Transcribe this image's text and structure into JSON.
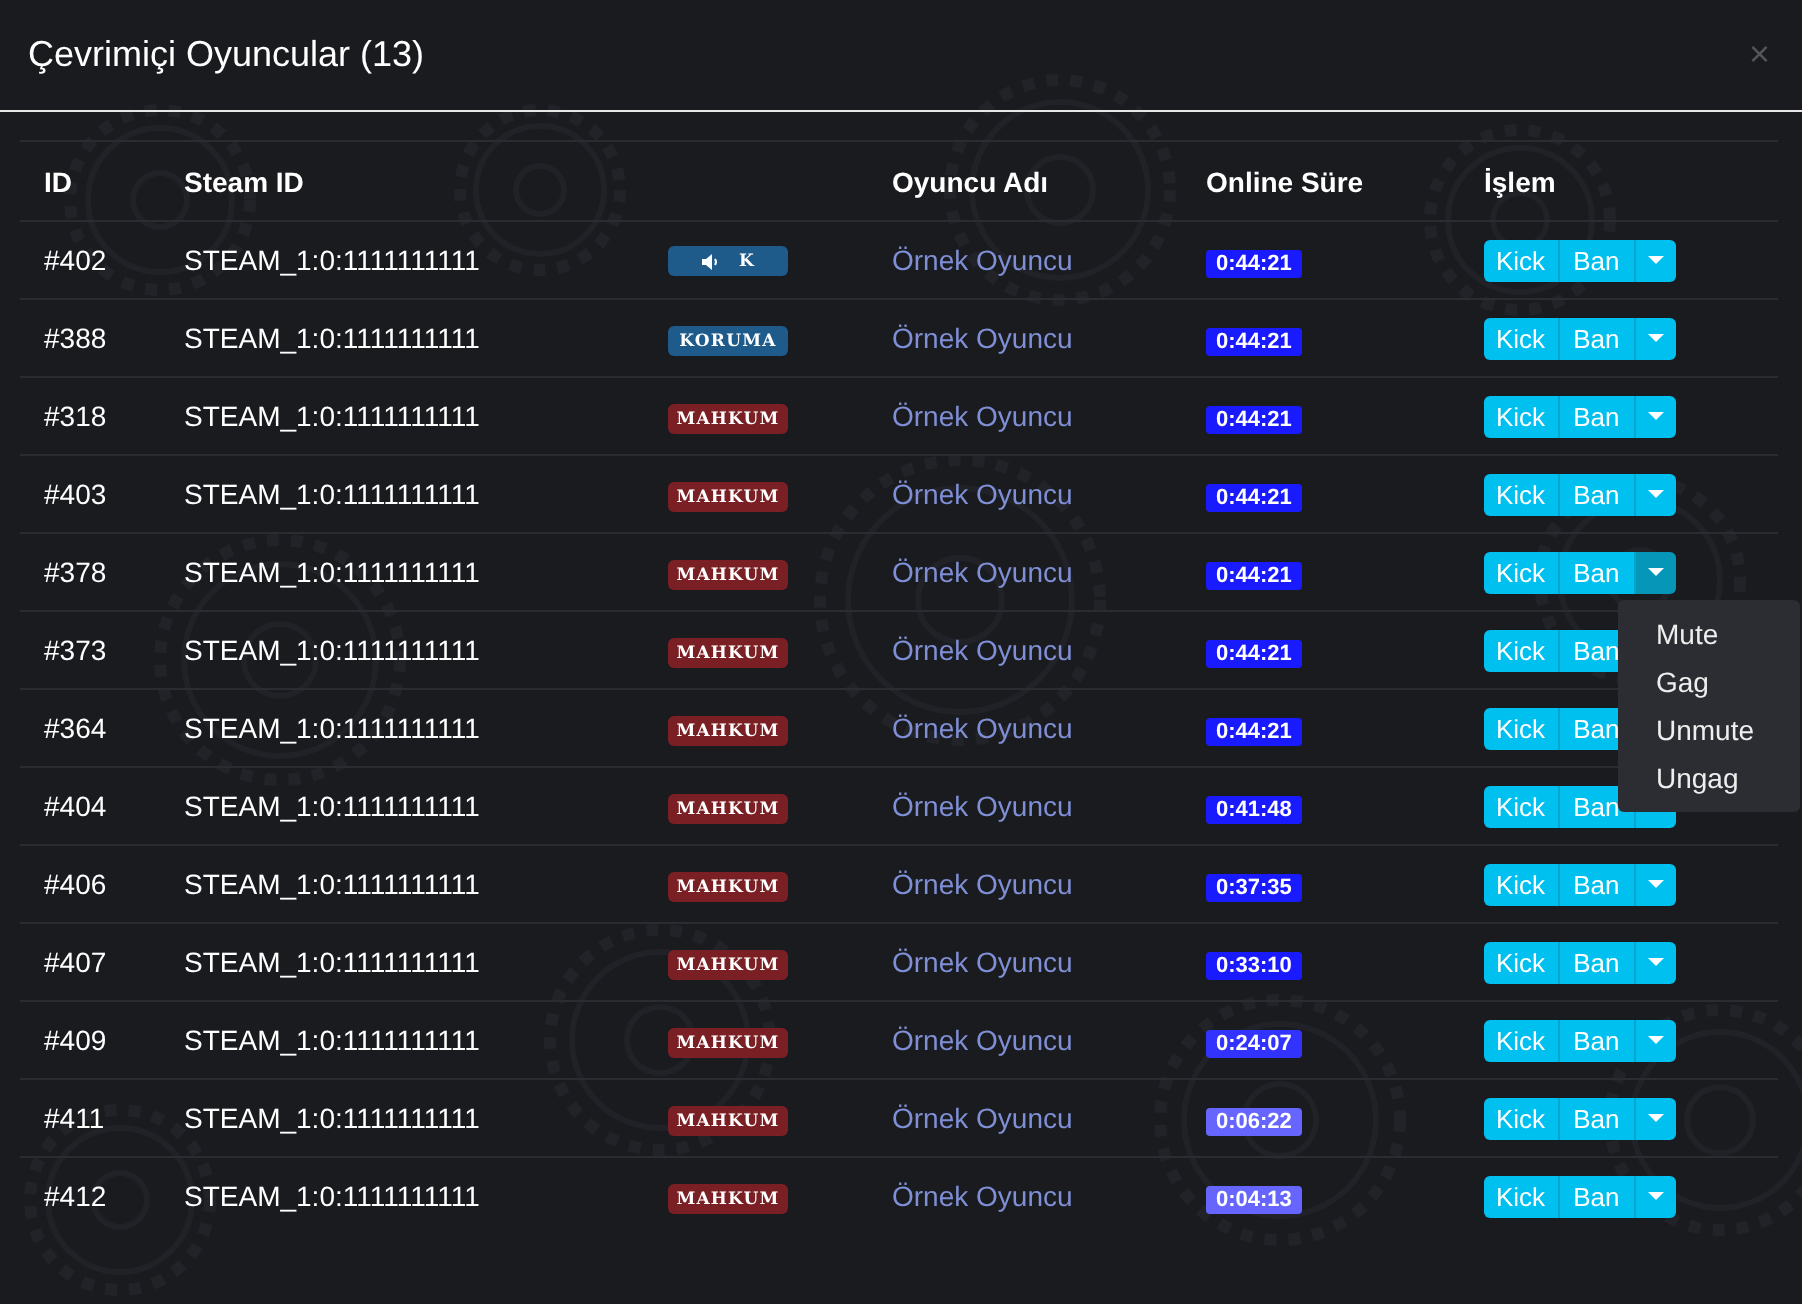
{
  "modal": {
    "title": "Çevrimiçi Oyuncular (13)",
    "close": "×"
  },
  "table": {
    "columns": [
      "ID",
      "Steam ID",
      "Oyuncu Adı",
      "Online Süre",
      "İşlem"
    ],
    "rows": [
      {
        "id": "#402",
        "steam_id": "STEAM_1:0:1111111111",
        "tag": {
          "kind": "muted",
          "label": "K"
        },
        "name": "Örnek Oyuncu",
        "time": {
          "text": "0:44:21",
          "color": "#1a1aff"
        },
        "kick": "Kick",
        "ban": "Ban",
        "menu_open": false
      },
      {
        "id": "#388",
        "steam_id": "STEAM_1:0:1111111111",
        "tag": {
          "kind": "guard",
          "label": "KORUMA"
        },
        "name": "Örnek Oyuncu",
        "time": {
          "text": "0:44:21",
          "color": "#1a1aff"
        },
        "kick": "Kick",
        "ban": "Ban",
        "menu_open": false
      },
      {
        "id": "#318",
        "steam_id": "STEAM_1:0:1111111111",
        "tag": {
          "kind": "prisoner",
          "label": "MAHKUM"
        },
        "name": "Örnek Oyuncu",
        "time": {
          "text": "0:44:21",
          "color": "#1a1aff"
        },
        "kick": "Kick",
        "ban": "Ban",
        "menu_open": false
      },
      {
        "id": "#403",
        "steam_id": "STEAM_1:0:1111111111",
        "tag": {
          "kind": "prisoner",
          "label": "MAHKUM"
        },
        "name": "Örnek Oyuncu",
        "time": {
          "text": "0:44:21",
          "color": "#1a1aff"
        },
        "kick": "Kick",
        "ban": "Ban",
        "menu_open": false
      },
      {
        "id": "#378",
        "steam_id": "STEAM_1:0:1111111111",
        "tag": {
          "kind": "prisoner",
          "label": "MAHKUM"
        },
        "name": "Örnek Oyuncu",
        "time": {
          "text": "0:44:21",
          "color": "#1a1aff"
        },
        "kick": "Kick",
        "ban": "Ban",
        "menu_open": true
      },
      {
        "id": "#373",
        "steam_id": "STEAM_1:0:1111111111",
        "tag": {
          "kind": "prisoner",
          "label": "MAHKUM"
        },
        "name": "Örnek Oyuncu",
        "time": {
          "text": "0:44:21",
          "color": "#1a1aff"
        },
        "kick": "Kick",
        "ban": "Ban"
      },
      {
        "id": "#364",
        "steam_id": "STEAM_1:0:1111111111",
        "tag": {
          "kind": "prisoner",
          "label": "MAHKUM"
        },
        "name": "Örnek Oyuncu",
        "time": {
          "text": "0:44:21",
          "color": "#1a1aff"
        },
        "kick": "Kick",
        "ban": "Ban"
      },
      {
        "id": "#404",
        "steam_id": "STEAM_1:0:1111111111",
        "tag": {
          "kind": "prisoner",
          "label": "MAHKUM"
        },
        "name": "Örnek Oyuncu",
        "time": {
          "text": "0:41:48",
          "color": "#1a1aff"
        },
        "kick": "Kick",
        "ban": "Ban",
        "menu_open": false
      },
      {
        "id": "#406",
        "steam_id": "STEAM_1:0:1111111111",
        "tag": {
          "kind": "prisoner",
          "label": "MAHKUM"
        },
        "name": "Örnek Oyuncu",
        "time": {
          "text": "0:37:35",
          "color": "#1a1aff"
        },
        "kick": "Kick",
        "ban": "Ban",
        "menu_open": false
      },
      {
        "id": "#407",
        "steam_id": "STEAM_1:0:1111111111",
        "tag": {
          "kind": "prisoner",
          "label": "MAHKUM"
        },
        "name": "Örnek Oyuncu",
        "time": {
          "text": "0:33:10",
          "color": "#1a1aff"
        },
        "kick": "Kick",
        "ban": "Ban",
        "menu_open": false
      },
      {
        "id": "#409",
        "steam_id": "STEAM_1:0:1111111111",
        "tag": {
          "kind": "prisoner",
          "label": "MAHKUM"
        },
        "name": "Örnek Oyuncu",
        "time": {
          "text": "0:24:07",
          "color": "#3333ff"
        },
        "kick": "Kick",
        "ban": "Ban",
        "menu_open": false
      },
      {
        "id": "#411",
        "steam_id": "STEAM_1:0:1111111111",
        "tag": {
          "kind": "prisoner",
          "label": "MAHKUM"
        },
        "name": "Örnek Oyuncu",
        "time": {
          "text": "0:06:22",
          "color": "#6666ff"
        },
        "kick": "Kick",
        "ban": "Ban",
        "menu_open": false
      },
      {
        "id": "#412",
        "steam_id": "STEAM_1:0:1111111111",
        "tag": {
          "kind": "prisoner",
          "label": "MAHKUM"
        },
        "name": "Örnek Oyuncu",
        "time": {
          "text": "0:04:13",
          "color": "#6666ff"
        },
        "kick": "Kick",
        "ban": "Ban",
        "menu_open": false
      }
    ]
  },
  "dropdown_menu": [
    "Mute",
    "Gag",
    "Unmute",
    "Ungag"
  ]
}
